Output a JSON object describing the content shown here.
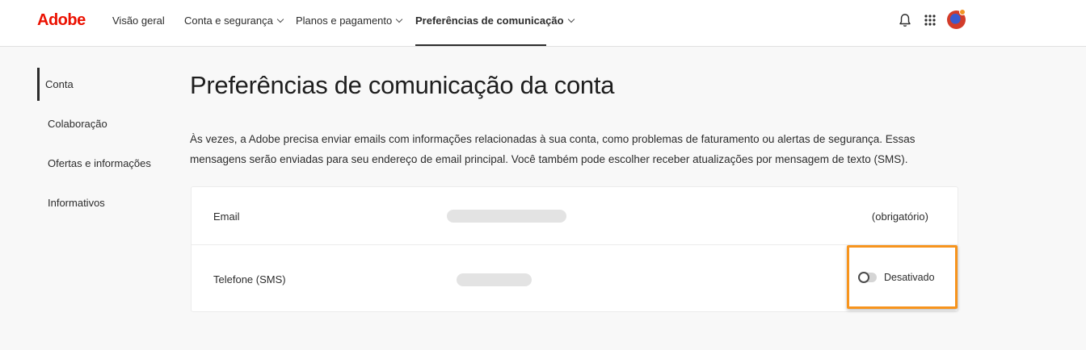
{
  "header": {
    "logo": "Adobe",
    "nav": [
      {
        "label": "Visão geral"
      },
      {
        "label": "Conta e segurança"
      },
      {
        "label": "Planos e pagamento"
      },
      {
        "label": "Preferências de comunicação"
      }
    ],
    "icons": [
      "bell-icon",
      "app-grid-icon",
      "avatar"
    ]
  },
  "sidebar": {
    "items": [
      {
        "label": "Conta"
      },
      {
        "label": "Colaboração"
      },
      {
        "label": "Ofertas e informações"
      },
      {
        "label": "Informativos"
      }
    ]
  },
  "main": {
    "title": "Preferências de comunicação da conta",
    "description": "Às vezes, a Adobe precisa enviar emails com informações relacionadas à sua conta, como problemas de faturamento ou alertas de segurança. Essas mensagens serão enviadas para seu endereço de email principal. Você também pode escolher receber atualizações por mensagem de texto (SMS).",
    "rows": [
      {
        "label": "Email",
        "status": "(obrigatório)"
      },
      {
        "label": "Telefone (SMS)",
        "toggle_label": "Desativado",
        "toggle_on": false
      }
    ]
  },
  "colors": {
    "brand": "#eb1000",
    "highlight": "#f7941d",
    "background": "#f8f8f8"
  }
}
